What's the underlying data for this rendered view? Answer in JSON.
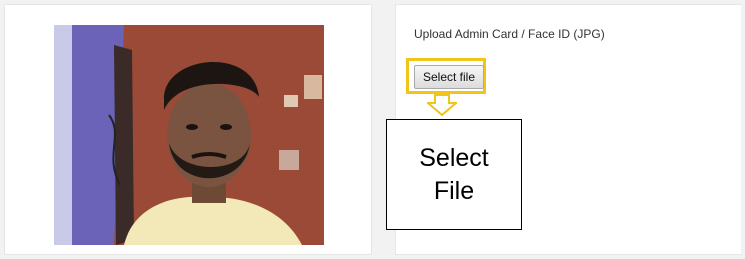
{
  "upload": {
    "label": "Upload Admin Card / Face ID (JPG)",
    "button_label": "Select file"
  },
  "annotation": {
    "callout_text": "Select\nFile",
    "highlight_color": "#f0c419"
  },
  "photo": {
    "icon": "webcam-photo"
  }
}
